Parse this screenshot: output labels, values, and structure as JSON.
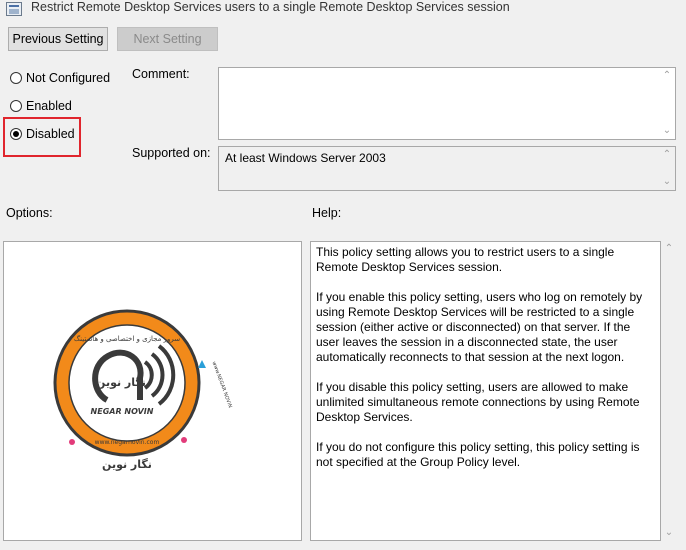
{
  "window": {
    "title": "Restrict Remote Desktop Services users to a single Remote Desktop Services session"
  },
  "toolbar": {
    "previous_label": "Previous Setting",
    "next_label": "Next Setting"
  },
  "state": {
    "options": [
      {
        "label": "Not Configured",
        "checked": false
      },
      {
        "label": "Enabled",
        "checked": false
      },
      {
        "label": "Disabled",
        "checked": true
      }
    ]
  },
  "comment": {
    "label": "Comment:",
    "value": ""
  },
  "supported": {
    "label": "Supported on:",
    "value": "At least Windows Server 2003"
  },
  "options_panel": {
    "label": "Options:"
  },
  "help": {
    "label": "Help:",
    "paragraphs": [
      "This policy setting allows you to restrict users to a single Remote Desktop Services session.",
      "If you enable this policy setting, users who log on remotely by using Remote Desktop Services will be restricted to a single session (either active or disconnected) on that server. If the user leaves the session in a disconnected state, the user automatically reconnects to that session at the next logon.",
      "If you disable this policy setting, users are allowed to make unlimited simultaneous remote connections by using Remote Desktop Services.",
      "If you do not configure this policy setting,  this policy setting is not specified at the Group Policy level."
    ]
  },
  "watermark": {
    "top_text": "سرور مجازی و اختصاصی و هاستینگ",
    "center_text": "نگار نوین",
    "brand": "NEGAR NOVIN",
    "url": "www.negarnovin.com",
    "bottom_text": "نگار نوین",
    "side_text": "www.NEGAR NOVIN",
    "colors": {
      "ring": "#f28a1a",
      "outline": "#3a3a3a",
      "accent": "#e23b7a",
      "blue": "#2a9fd8"
    }
  },
  "colors": {
    "highlight_border": "#e0252d",
    "window_bg": "#f0f0f0"
  }
}
